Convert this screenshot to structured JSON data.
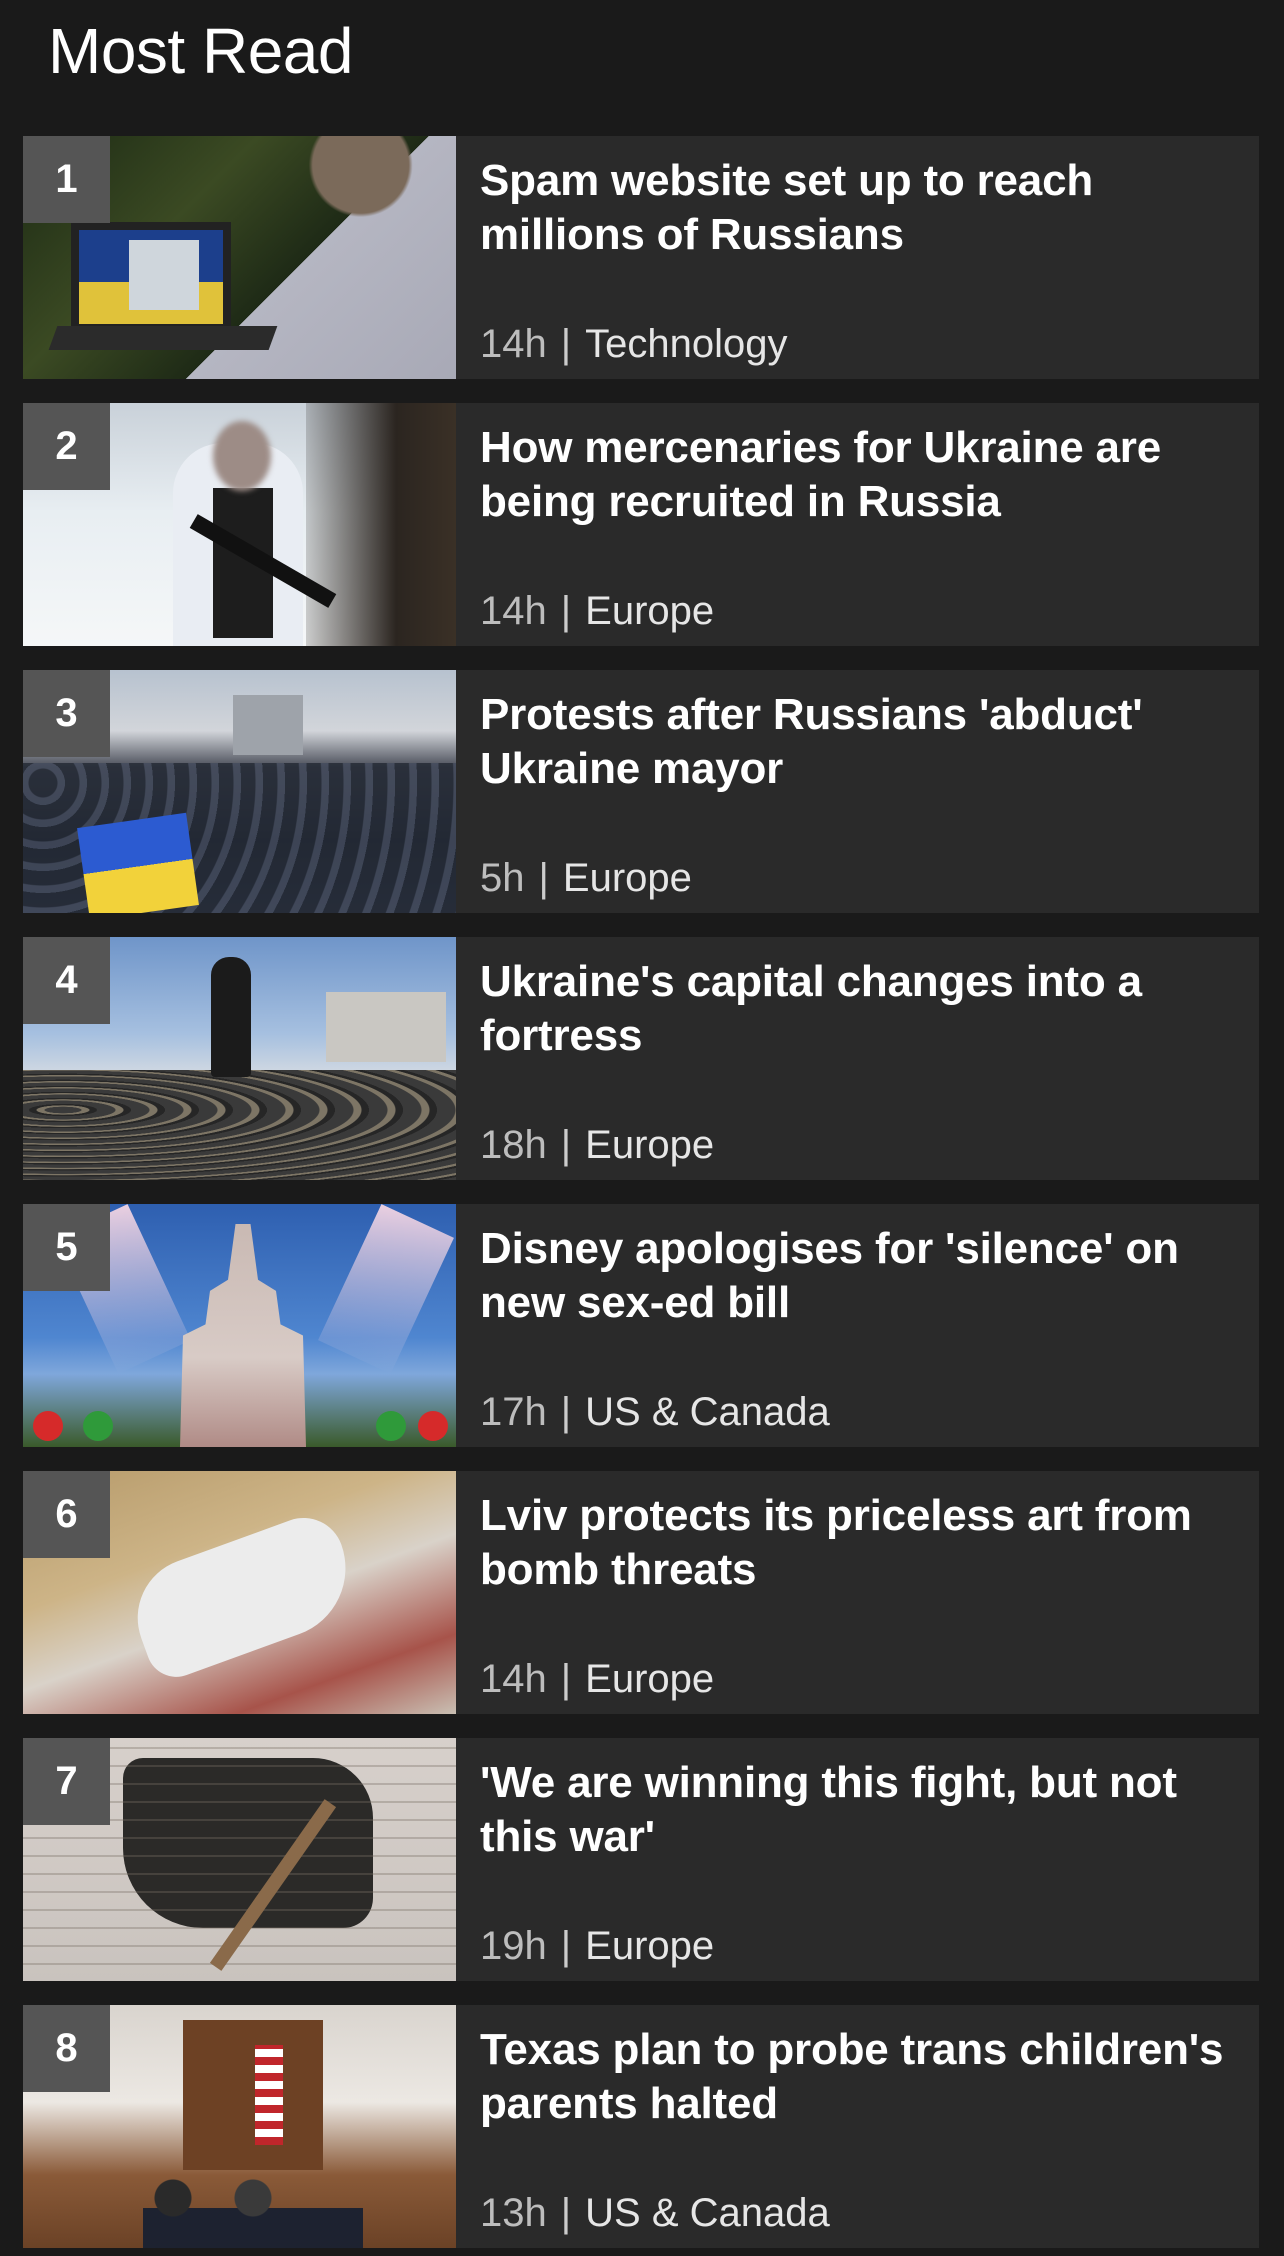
{
  "section": {
    "title": "Most Read"
  },
  "items": [
    {
      "rank": "1",
      "headline": "Spam website set up to reach millions of Russians",
      "age": "14h",
      "separator": "|",
      "category": "Technology"
    },
    {
      "rank": "2",
      "headline": "How mercenaries for Ukraine are being recruited in Russia",
      "age": "14h",
      "separator": "|",
      "category": "Europe"
    },
    {
      "rank": "3",
      "headline": "Protests after Russians 'abduct' Ukraine mayor",
      "age": "5h",
      "separator": "|",
      "category": "Europe"
    },
    {
      "rank": "4",
      "headline": "Ukraine's capital changes into a fortress",
      "age": "18h",
      "separator": "|",
      "category": "Europe"
    },
    {
      "rank": "5",
      "headline": "Disney apologises for 'silence' on new sex-ed bill",
      "age": "17h",
      "separator": "|",
      "category": "US & Canada"
    },
    {
      "rank": "6",
      "headline": "Lviv protects its priceless art from bomb threats",
      "age": "14h",
      "separator": "|",
      "category": "Europe"
    },
    {
      "rank": "7",
      "headline": "'We are winning this fight, but not this war'",
      "age": "19h",
      "separator": "|",
      "category": "Europe"
    },
    {
      "rank": "8",
      "headline": "Texas plan to probe trans children's parents halted",
      "age": "13h",
      "separator": "|",
      "category": "US & Canada"
    }
  ],
  "colors": {
    "background": "#1a1a1a",
    "card": "#2a2a2a",
    "rank_badge": "#555555",
    "text": "#ffffff",
    "meta_text": "#d6d6d6"
  }
}
